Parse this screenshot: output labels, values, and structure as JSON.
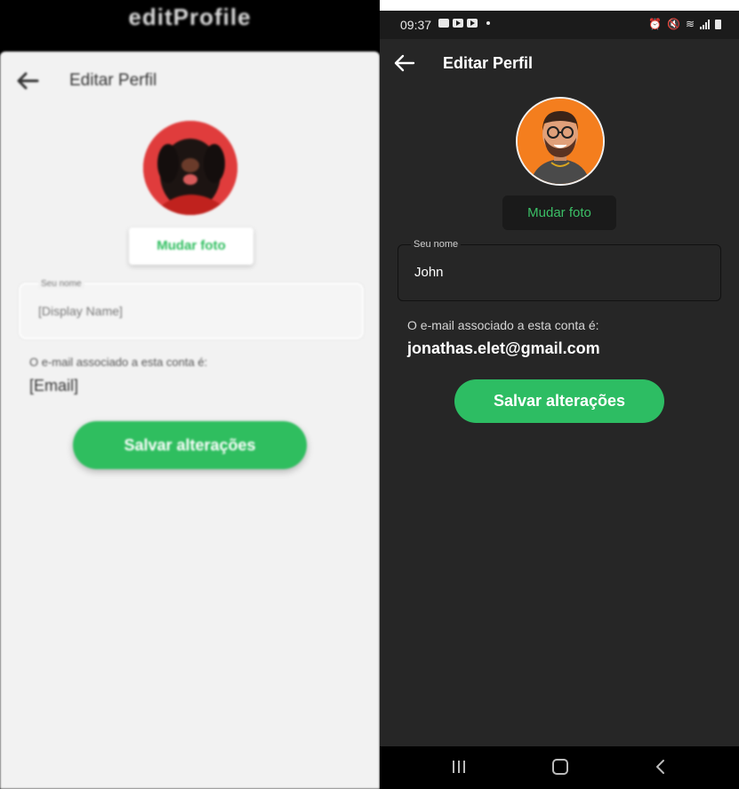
{
  "mockup": {
    "title": "editProfile",
    "header_title": "Editar Perfil",
    "change_photo_label": "Mudar foto",
    "name_field_label": "Seu nome",
    "name_field_value": "[Display Name]",
    "email_note": "O e-mail associado a esta conta é:",
    "email_value": "[Email]",
    "save_label": "Salvar alterações"
  },
  "phone": {
    "status_bar": {
      "time": "09:37"
    },
    "header_title": "Editar Perfil",
    "change_photo_label": "Mudar foto",
    "name_field_label": "Seu nome",
    "name_field_value": "John",
    "email_note": "O e-mail associado a esta conta é:",
    "email_value": "jonathas.elet@gmail.com",
    "save_label": "Salvar alterações"
  },
  "colors": {
    "accent_green": "#2dbd63",
    "dark_background": "#262626",
    "light_background": "#f2f2f2"
  },
  "icons": [
    "back-arrow-icon",
    "avatar-image",
    "recent-apps-icon",
    "home-icon",
    "nav-back-icon"
  ]
}
